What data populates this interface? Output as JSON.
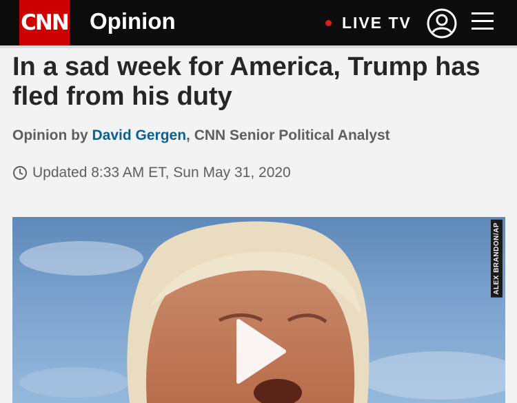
{
  "header": {
    "logo_text": "CNN",
    "section": "Opinion",
    "live_label": "LIVE TV",
    "account_icon": "user-circle-icon",
    "menu_icon": "hamburger-menu-icon",
    "brand_color": "#cc0000"
  },
  "article": {
    "headline": "In a sad week for America, Trump has fled from his duty",
    "byline_prefix": "Opinion by ",
    "author": "David Gergen",
    "byline_suffix": ", CNN Senior Political Analyst",
    "timestamp": "Updated 8:33 AM ET, Sun May 31, 2020",
    "timestamp_icon": "clock-icon"
  },
  "media": {
    "credit": "ALEX BRANDON/AP",
    "play_icon": "play-icon"
  }
}
